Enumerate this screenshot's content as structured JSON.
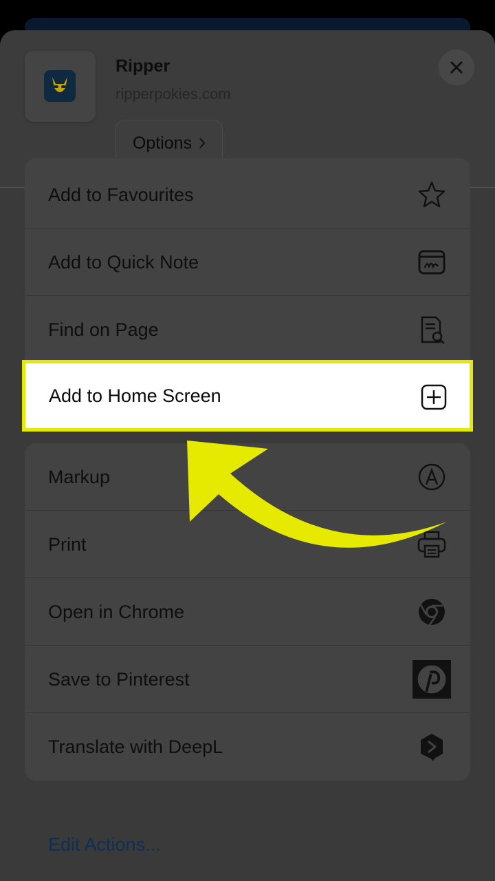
{
  "header": {
    "title": "Ripper",
    "url": "ripperpokies.com",
    "options_label": "Options",
    "close_icon": "close-icon",
    "logo_icon": "kangaroo-logo-icon"
  },
  "menu": {
    "group1": [
      {
        "label": "Add to Favourites",
        "icon": "star-icon"
      },
      {
        "label": "Add to Quick Note",
        "icon": "quick-note-icon"
      },
      {
        "label": "Find on Page",
        "icon": "find-on-page-icon"
      }
    ],
    "highlighted": {
      "label": "Add to Home Screen",
      "icon": "plus-square-icon"
    },
    "group2": [
      {
        "label": "Markup",
        "icon": "markup-icon"
      },
      {
        "label": "Print",
        "icon": "printer-icon"
      },
      {
        "label": "Open in Chrome",
        "icon": "chrome-icon"
      },
      {
        "label": "Save to Pinterest",
        "icon": "pinterest-icon"
      },
      {
        "label": "Translate with DeepL",
        "icon": "deepl-icon"
      }
    ]
  },
  "footer": {
    "edit_actions": "Edit Actions..."
  },
  "colors": {
    "highlight_border": "#e6ea00",
    "arrow": "#e6ea00",
    "link": "#0c2f56"
  }
}
